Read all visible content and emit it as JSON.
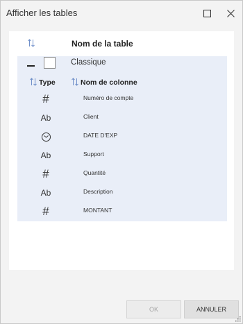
{
  "dialog": {
    "title": "Afficher les tables"
  },
  "table_header": {
    "label": "Nom de la table"
  },
  "group": {
    "name": "Classique",
    "checked": false,
    "columns_header": {
      "type_label": "Type",
      "name_label": "Nom de colonne"
    },
    "rows": [
      {
        "type_icon": "hash-icon",
        "type_glyph": "#",
        "name": "Numéro de compte"
      },
      {
        "type_icon": "text-icon",
        "type_glyph": "Ab",
        "name": "Client"
      },
      {
        "type_icon": "clock-icon",
        "type_glyph": "",
        "name": "DATE D'EXP"
      },
      {
        "type_icon": "text-icon",
        "type_glyph": "Ab",
        "name": "Support"
      },
      {
        "type_icon": "hash-icon",
        "type_glyph": "#",
        "name": "Quantité"
      },
      {
        "type_icon": "text-icon",
        "type_glyph": "Ab",
        "name": "Description"
      },
      {
        "type_icon": "hash-icon",
        "type_glyph": "#",
        "name": "MONTANT"
      }
    ]
  },
  "footer": {
    "ok_label": "OK",
    "cancel_label": "ANNULER",
    "ok_enabled": false
  },
  "colors": {
    "group_bg": "#e9eef8",
    "sort_icon": "#6f8fc9"
  }
}
